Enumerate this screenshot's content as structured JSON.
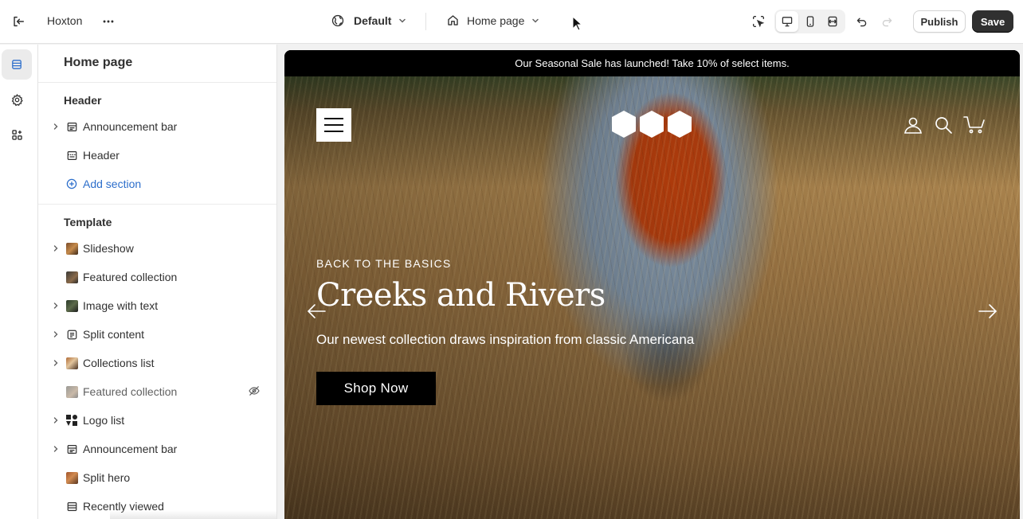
{
  "topbar": {
    "theme_name": "Hoxton",
    "theme_selector": "Default",
    "page_selector": "Home page",
    "publish_label": "Publish",
    "save_label": "Save",
    "icons": [
      "exit-icon",
      "more-icon",
      "globe-icon",
      "chevron-down-icon",
      "home-icon",
      "inspector-icon",
      "desktop-icon",
      "mobile-icon",
      "fullwidth-icon",
      "undo-icon",
      "redo-icon"
    ]
  },
  "rail": {
    "items": [
      "sections-icon",
      "settings-icon",
      "apps-icon"
    ],
    "active": "sections-icon"
  },
  "sidebar": {
    "title": "Home page",
    "header_group": {
      "title": "Header",
      "items": [
        {
          "label": "Announcement bar",
          "icon": "announcement-icon",
          "expandable": true
        },
        {
          "label": "Header",
          "icon": "header-icon",
          "expandable": false
        }
      ],
      "add_label": "Add section"
    },
    "template_group": {
      "title": "Template",
      "items": [
        {
          "label": "Slideshow",
          "icon": "slideshow-thumb",
          "expandable": true
        },
        {
          "label": "Featured collection",
          "icon": "featured-thumb",
          "expandable": false
        },
        {
          "label": "Image with text",
          "icon": "image-text-thumb",
          "expandable": true
        },
        {
          "label": "Split content",
          "icon": "split-content-icon",
          "expandable": true
        },
        {
          "label": "Collections list",
          "icon": "collections-thumb",
          "expandable": true
        },
        {
          "label": "Featured collection",
          "icon": "featured-thumb",
          "expandable": false,
          "hidden": true
        },
        {
          "label": "Logo list",
          "icon": "logo-list-thumb",
          "expandable": true
        },
        {
          "label": "Announcement bar",
          "icon": "announcement-icon",
          "expandable": true
        },
        {
          "label": "Split hero",
          "icon": "split-hero-thumb",
          "expandable": false
        },
        {
          "label": "Recently viewed",
          "icon": "recently-viewed-icon",
          "expandable": false
        }
      ]
    }
  },
  "preview": {
    "announcement": "Our Seasonal Sale has launched! Take 10% of select items.",
    "eyebrow": "BACK TO THE BASICS",
    "headline": "Creeks and Rivers",
    "subheading": "Our newest collection draws inspiration from classic Americana",
    "cta_label": "Shop Now",
    "header_icons": [
      "account-icon",
      "search-icon",
      "cart-icon"
    ]
  },
  "colors": {
    "accent_link": "#2c6ecb",
    "save_bg": "#303030",
    "announcement_bg": "#000000"
  }
}
